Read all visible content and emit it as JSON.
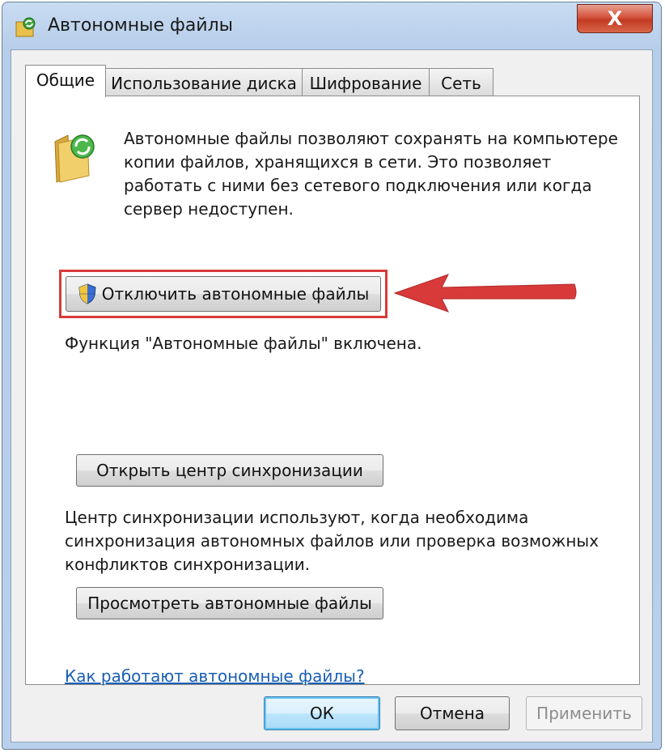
{
  "window": {
    "title": "Автономные файлы",
    "close_label": "X"
  },
  "tabs": [
    {
      "label": "Общие",
      "active": true
    },
    {
      "label": "Использование диска",
      "active": false
    },
    {
      "label": "Шифрование",
      "active": false
    },
    {
      "label": "Сеть",
      "active": false
    }
  ],
  "general": {
    "description": "Автономные файлы позволяют сохранять на компьютере копии файлов, хранящихся в сети.  Это позволяет работать с ними без сетевого подключения или когда сервер недоступен.",
    "disable_button": "Отключить автономные файлы",
    "status": "Функция \"Автономные файлы\" включена.",
    "sync_button": "Открыть центр синхронизации",
    "sync_description": "Центр синхронизации используют, когда необходима синхронизация автономных файлов или проверка возможных конфликтов синхронизации.",
    "view_button": "Просмотреть автономные файлы",
    "help_link": "Как работают автономные файлы?"
  },
  "footer": {
    "ok": "ОК",
    "cancel": "Отмена",
    "apply": "Применить"
  },
  "colors": {
    "highlight": "#d83a3a",
    "arrow": "#d83a3a",
    "link": "#1a5fb4"
  }
}
